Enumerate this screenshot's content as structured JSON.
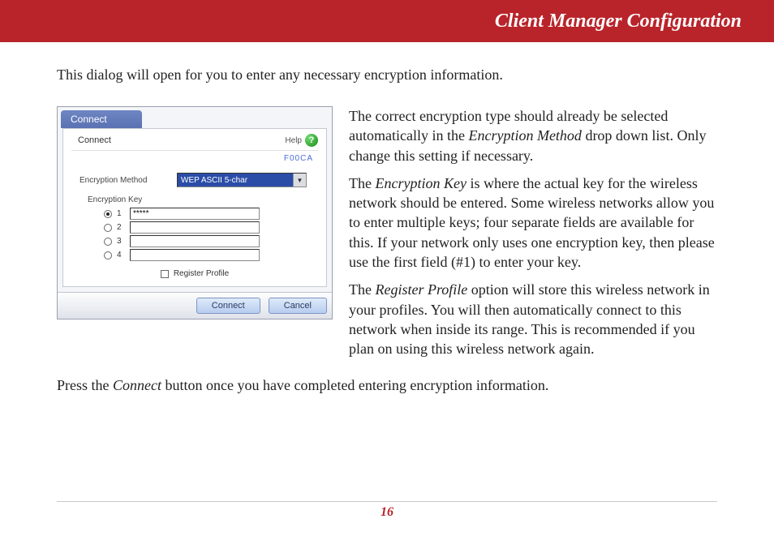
{
  "header": {
    "title": "Client Manager Configuration"
  },
  "intro": "This dialog will open for you to enter any necessary encryption information.",
  "dialog": {
    "title": "Connect",
    "tab": "Connect",
    "help_label": "Help",
    "network_id": "F00CA",
    "enc_method_label": "Encryption Method",
    "enc_method_value": "WEP ASCII 5-char",
    "enc_key_label": "Encryption Key",
    "keys": [
      {
        "n": "1",
        "value": "*****",
        "selected": true
      },
      {
        "n": "2",
        "value": "",
        "selected": false
      },
      {
        "n": "3",
        "value": "",
        "selected": false
      },
      {
        "n": "4",
        "value": "",
        "selected": false
      }
    ],
    "register_label": "Register Profile",
    "connect_btn": "Connect",
    "cancel_btn": "Cancel"
  },
  "body": {
    "p1a": "The correct encryption type should already be selected automatically in the ",
    "p1b": "Encryption Method",
    "p1c": " drop down list.  Only change this setting if necessary.",
    "p2a": "The ",
    "p2b": "Encryption Key",
    "p2c": " is where the actual key for the wireless network should be entered.  Some wireless networks allow you to enter multiple keys; four separate fields are available for this.  If your network only uses one encryption key, then please use the first field (#1) to enter your key.",
    "p3a": "The ",
    "p3b": "Register Profile",
    "p3c": " option will store this wireless network in your profiles.  You will then automatically connect to this network when inside its range.  This is recommended if you plan on using this wireless network again."
  },
  "after_a": "Press the ",
  "after_b": "Connect",
  "after_c": " button once you have completed entering encryption information.",
  "page_number": "16"
}
